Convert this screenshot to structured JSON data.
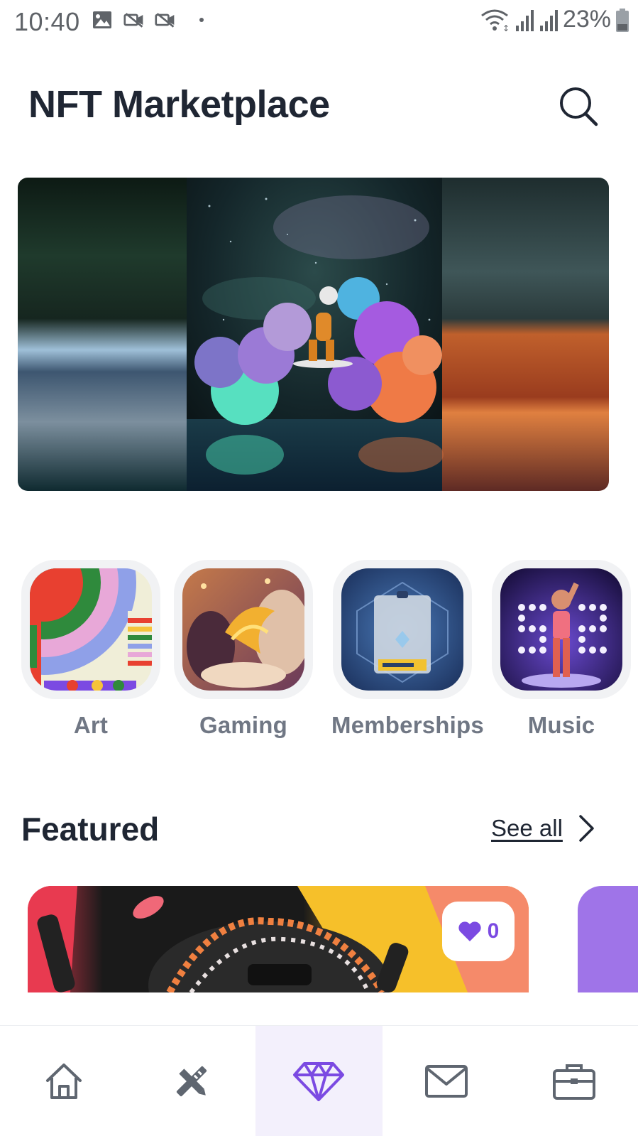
{
  "status_bar": {
    "time": "10:40",
    "battery": "23%",
    "left_icons": [
      "gallery-icon",
      "video-off-icon",
      "video-off-icon",
      "dot-icon"
    ],
    "right_icons": [
      "wifi-icon",
      "signal-icon",
      "signal-icon",
      "battery-icon"
    ]
  },
  "header": {
    "title": "NFT Marketplace",
    "search_icon": "search-icon"
  },
  "categories": [
    {
      "label": "Art"
    },
    {
      "label": "Gaming"
    },
    {
      "label": "Memberships"
    },
    {
      "label": "Music"
    }
  ],
  "featured": {
    "title": "Featured",
    "see_all": "See all",
    "cards": [
      {
        "likes": "0"
      }
    ]
  },
  "nav": {
    "items": [
      "home-icon",
      "tools-icon",
      "diamond-icon",
      "mail-icon",
      "briefcase-icon"
    ],
    "active_index": 2
  },
  "colors": {
    "accent": "#7b4ae2",
    "text_dark": "#1f2633",
    "text_muted": "#707784",
    "active_nav_bg": "#f3f0fc"
  }
}
